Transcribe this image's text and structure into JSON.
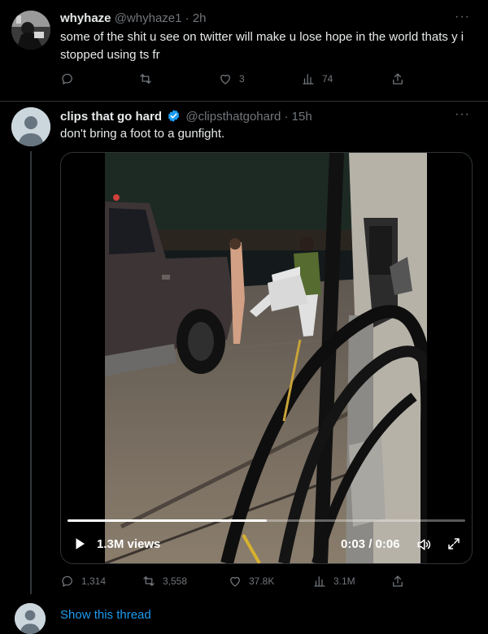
{
  "tweet1": {
    "display_name": "whyhaze",
    "handle": "@whyhaze1",
    "time": "2h",
    "text": "some of the shit u see on twitter will make u lose hope in the world thats y i stopped using ts fr",
    "actions": {
      "reply_count": "",
      "retweet_count": "",
      "like_count": "3",
      "views_count": "74"
    }
  },
  "tweet2": {
    "display_name": "clips that go hard",
    "handle": "@clipsthatgohard",
    "time": "15h",
    "text": "don't bring a foot to a gunfight.",
    "video": {
      "views": "1.3M views",
      "time_display": "0:03 / 0:06",
      "progress": 0.5
    },
    "actions": {
      "reply_count": "1,314",
      "retweet_count": "3,558",
      "like_count": "37.8K",
      "views_count": "3.1M"
    }
  },
  "thread": {
    "show_thread_label": "Show this thread"
  },
  "misc": {
    "separator": "·",
    "more_glyph": "···"
  },
  "colors": {
    "background": "#000000",
    "text_primary": "#e7e9ea",
    "text_secondary": "#71767b",
    "link": "#1d9bf0",
    "verified": "#1d9bf0",
    "divider": "#2f3336"
  }
}
